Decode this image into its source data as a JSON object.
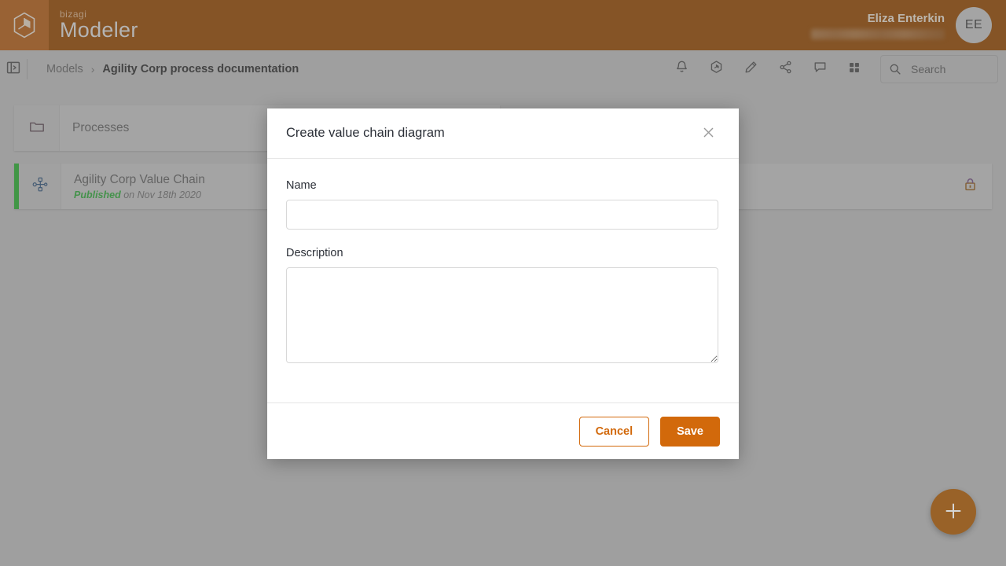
{
  "app": {
    "brand_small": "bizagi",
    "brand_main": "Modeler",
    "logo_icon": "cube-logo-icon"
  },
  "header": {
    "user_name": "Eliza Enterkin",
    "user_email_redacted": "",
    "avatar_initials": "EE"
  },
  "breadcrumb": {
    "panel_toggle_icon": "panel-toggle-icon",
    "root_label": "Models",
    "separator": "›",
    "current_label": "Agility Corp process documentation"
  },
  "toolbar": {
    "icons": [
      {
        "name": "bell-icon",
        "title": "Notifications"
      },
      {
        "name": "hexagon-badge-icon",
        "title": "Model info"
      },
      {
        "name": "pencil-icon",
        "title": "Edit"
      },
      {
        "name": "share-icon",
        "title": "Share"
      },
      {
        "name": "comment-icon",
        "title": "Comments"
      },
      {
        "name": "grid-apps-icon",
        "title": "Apps"
      }
    ],
    "search": {
      "placeholder": "Search",
      "value": "",
      "icon": "search-icon"
    }
  },
  "content": {
    "folder_card": {
      "icon": "folder-icon",
      "label": "Processes"
    },
    "model_card": {
      "icon": "value-chain-node-icon",
      "title": "Agility Corp Value Chain",
      "status_label": "Published",
      "status_detail": "on Nov 18th 2020",
      "status_color": "#2f9e38",
      "lock_icon": "lock-icon",
      "accent_color": "#2aa432"
    },
    "fab": {
      "icon": "plus-icon",
      "label": "+",
      "color": "#a85a06"
    }
  },
  "modal": {
    "title": "Create value chain diagram",
    "close_icon": "close-icon",
    "fields": {
      "name": {
        "label": "Name",
        "value": "",
        "placeholder": ""
      },
      "description": {
        "label": "Description",
        "value": "",
        "placeholder": ""
      }
    },
    "buttons": {
      "cancel": "Cancel",
      "save": "Save"
    }
  },
  "colors": {
    "header_bg": "#8b4503",
    "logo_tile": "#a85a18",
    "accent_orange": "#d2690b",
    "page_bg": "#b0b0b0",
    "card_bg": "#b8b8b8",
    "published_green": "#2f9e38"
  }
}
